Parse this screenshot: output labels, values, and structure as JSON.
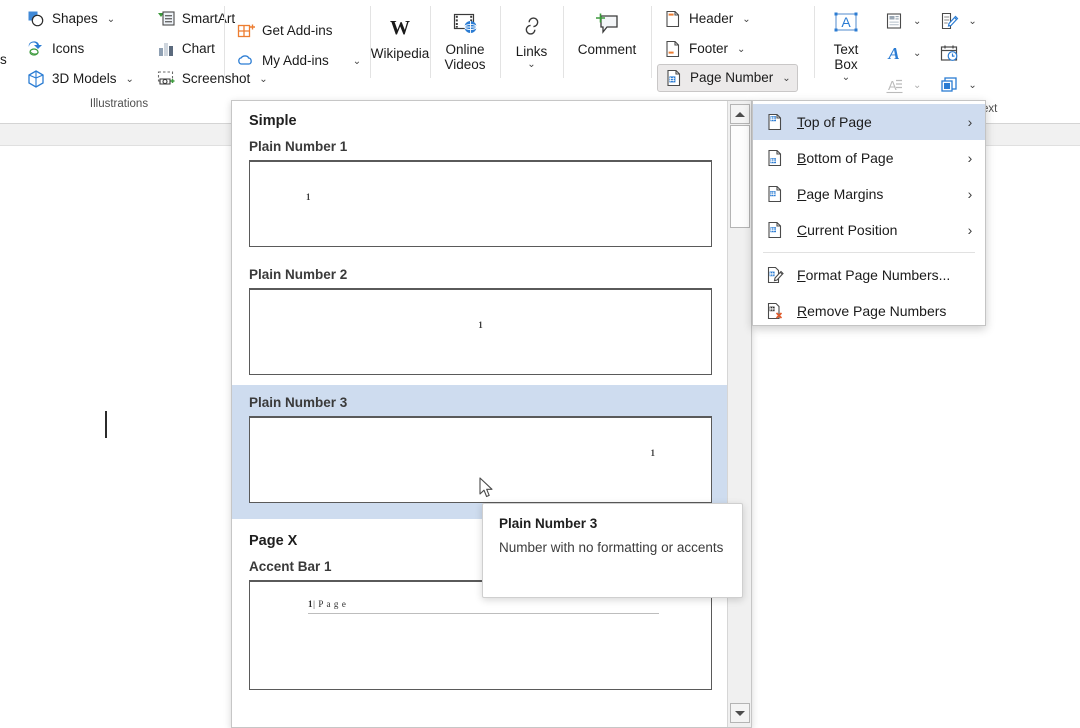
{
  "ribbon": {
    "cutoff_fragment": "s",
    "groups": [
      {
        "name": "illustrations",
        "label": "Illustrations",
        "buttons": [
          {
            "label": "Shapes",
            "icon": "shapes-icon",
            "has_chevron": true
          },
          {
            "label": "Icons",
            "icon": "icons-icon",
            "has_chevron": false
          },
          {
            "label": "3D Models",
            "icon": "3d-models-icon",
            "has_chevron": true
          },
          {
            "label": "SmartArt",
            "icon": "smartart-icon",
            "has_chevron": false
          },
          {
            "label": "Chart",
            "icon": "chart-icon",
            "has_chevron": false
          },
          {
            "label": "Screenshot",
            "icon": "screenshot-icon",
            "has_chevron": true
          }
        ]
      },
      {
        "name": "add-ins",
        "label": "",
        "buttons": [
          {
            "label": "Get Add-ins",
            "icon": "get-addins-icon",
            "has_chevron": false
          },
          {
            "label": "My Add-ins",
            "icon": "my-addins-icon",
            "has_chevron": true
          }
        ]
      },
      {
        "name": "media",
        "label": "",
        "buttons": [
          {
            "label": "Wikipedia",
            "icon": "wikipedia-icon"
          },
          {
            "label": "Online Videos",
            "icon": "online-videos-icon"
          }
        ]
      },
      {
        "name": "links-comments",
        "label": "",
        "buttons": [
          {
            "label": "Links",
            "icon": "links-icon",
            "has_chevron": true
          },
          {
            "label": "Comment",
            "icon": "comment-icon",
            "has_chevron": false
          }
        ]
      },
      {
        "name": "header-footer",
        "label": "",
        "buttons": [
          {
            "label": "Header",
            "icon": "header-icon",
            "has_chevron": true
          },
          {
            "label": "Footer",
            "icon": "footer-icon",
            "has_chevron": true
          },
          {
            "label": "Page Number",
            "icon": "page-number-icon",
            "has_chevron": true,
            "active": true
          }
        ]
      },
      {
        "name": "text",
        "label": "Text",
        "label_clipped": "ext",
        "buttons": [
          {
            "label": "Text Box",
            "icon": "text-box-icon",
            "has_chevron": true
          },
          {
            "label": "",
            "icon": "quick-parts-icon",
            "has_chevron": true
          },
          {
            "label": "",
            "icon": "wordart-icon",
            "has_chevron": true
          },
          {
            "label": "",
            "icon": "drop-cap-icon",
            "has_chevron": true,
            "disabled": true
          },
          {
            "label": "",
            "icon": "signature-line-icon",
            "has_chevron": true
          },
          {
            "label": "",
            "icon": "date-time-icon",
            "has_chevron": false
          },
          {
            "label": "",
            "icon": "object-icon",
            "has_chevron": true
          }
        ]
      }
    ]
  },
  "menu": {
    "items": [
      {
        "label": "Top of Page",
        "accel": "T",
        "icon": "page-top-icon",
        "submenu": true,
        "selected": true
      },
      {
        "label": "Bottom of Page",
        "accel": "B",
        "icon": "page-bottom-icon",
        "submenu": true,
        "selected": false
      },
      {
        "label": "Page Margins",
        "accel": "P",
        "icon": "page-margins-icon",
        "submenu": true,
        "selected": false
      },
      {
        "label": "Current Position",
        "accel": "C",
        "icon": "current-position-icon",
        "submenu": true,
        "selected": false
      },
      {
        "label": "Format Page Numbers...",
        "accel": "F",
        "icon": "format-page-numbers-icon",
        "submenu": false,
        "selected": false
      },
      {
        "label": "Remove Page Numbers",
        "accel": "R",
        "icon": "remove-page-numbers-icon",
        "submenu": false,
        "selected": false
      }
    ],
    "submenu_arrow": "›"
  },
  "gallery": {
    "sections": [
      {
        "title": "Simple",
        "items": [
          {
            "title": "Plain Number 1",
            "number": "1",
            "align": "left",
            "selected": false
          },
          {
            "title": "Plain Number 2",
            "number": "1",
            "align": "center",
            "selected": false
          },
          {
            "title": "Plain Number 3",
            "number": "1",
            "align": "right",
            "selected": true
          }
        ]
      },
      {
        "title": "Page X",
        "items": [
          {
            "title": "Accent Bar 1",
            "number": "1",
            "accent_suffix": "| P a g e",
            "align": "left-accent",
            "selected": false
          }
        ]
      }
    ]
  },
  "tooltip": {
    "title": "Plain Number 3",
    "description": "Number with no formatting or accents"
  },
  "colors": {
    "selection_blue": "#cedcef",
    "menu_selection": "#cfdcef",
    "accent_orange": "#ed7d31",
    "accent_blue": "#2b7cd3",
    "accent_green": "#3c9a3c",
    "ribbon_border": "#d4d4d4"
  }
}
